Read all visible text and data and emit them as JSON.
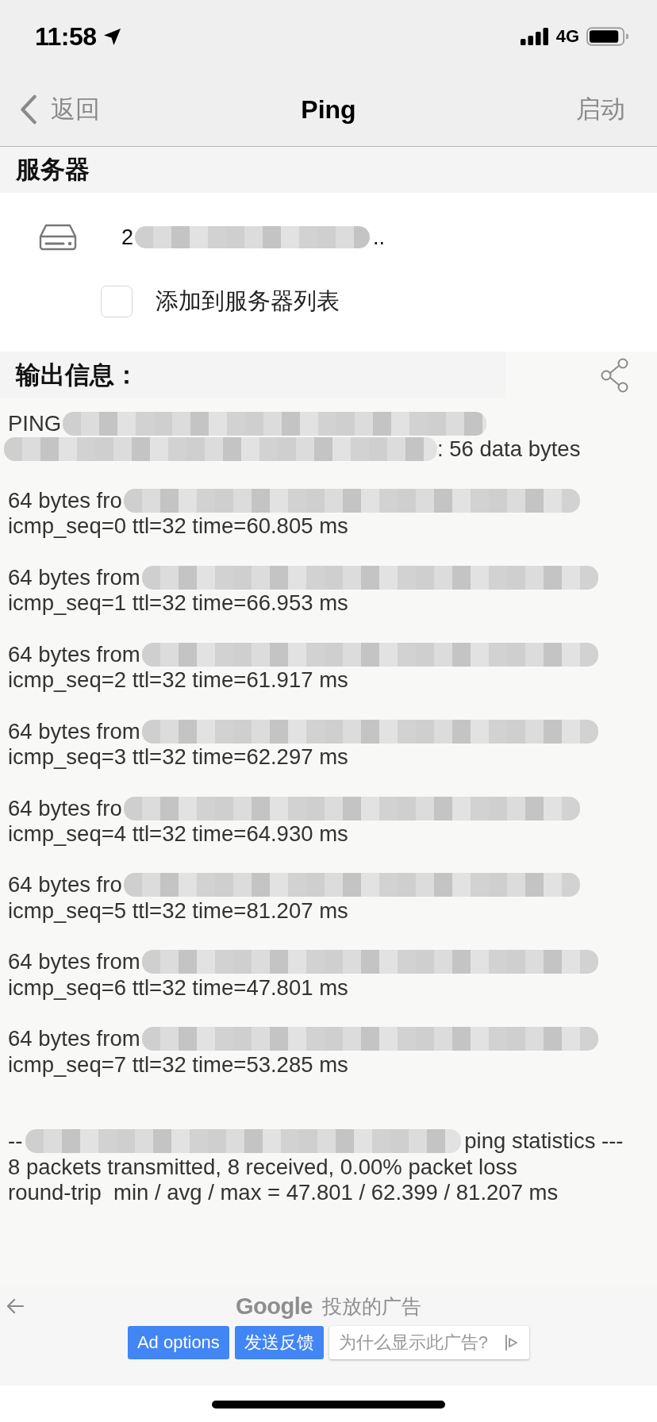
{
  "status_bar": {
    "time": "11:58",
    "network": "4G"
  },
  "nav_bar": {
    "back_label": "返回",
    "title": "Ping",
    "action_label": "启动"
  },
  "server_section": {
    "title": "服务器",
    "address_start": "2",
    "address_end": "..",
    "add_to_list": {
      "label": "添加到服务器列表",
      "checked": false
    }
  },
  "output_section": {
    "title": "输出信息：",
    "ping_header": {
      "start": "PING",
      "end": ": 56 data bytes"
    },
    "replies": [
      {
        "start": "64 bytes fro",
        "detail": "icmp_seq=0 ttl=32 time=60.805 ms"
      },
      {
        "start": "64 bytes from",
        "detail": "icmp_seq=1 ttl=32 time=66.953 ms"
      },
      {
        "start": "64 bytes from",
        "detail": "icmp_seq=2 ttl=32 time=61.917 ms"
      },
      {
        "start": "64 bytes from",
        "detail": "icmp_seq=3 ttl=32 time=62.297 ms"
      },
      {
        "start": "64 bytes fro",
        "detail": "icmp_seq=4 ttl=32 time=64.930 ms"
      },
      {
        "start": "64 bytes fro",
        "detail": "icmp_seq=5 ttl=32 time=81.207 ms"
      },
      {
        "start": "64 bytes from",
        "detail": "icmp_seq=6 ttl=32 time=47.801 ms"
      },
      {
        "start": "64 bytes from",
        "detail": "icmp_seq=7 ttl=32 time=53.285 ms"
      }
    ],
    "statistics": {
      "start": "--",
      "end": "ping statistics ---",
      "lines": [
        "8 packets transmitted, 8 received, 0.00% packet loss",
        "round-trip  min / avg / max = 47.801 / 62.399 / 81.207 ms"
      ]
    }
  },
  "ad_bar": {
    "brand": "Google",
    "caption": "投放的广告",
    "buttons": [
      {
        "label": "Ad options",
        "kind": "primary"
      },
      {
        "label": "发送反馈",
        "kind": "primary"
      },
      {
        "label": "为什么显示此广告?",
        "kind": "outline"
      }
    ]
  }
}
